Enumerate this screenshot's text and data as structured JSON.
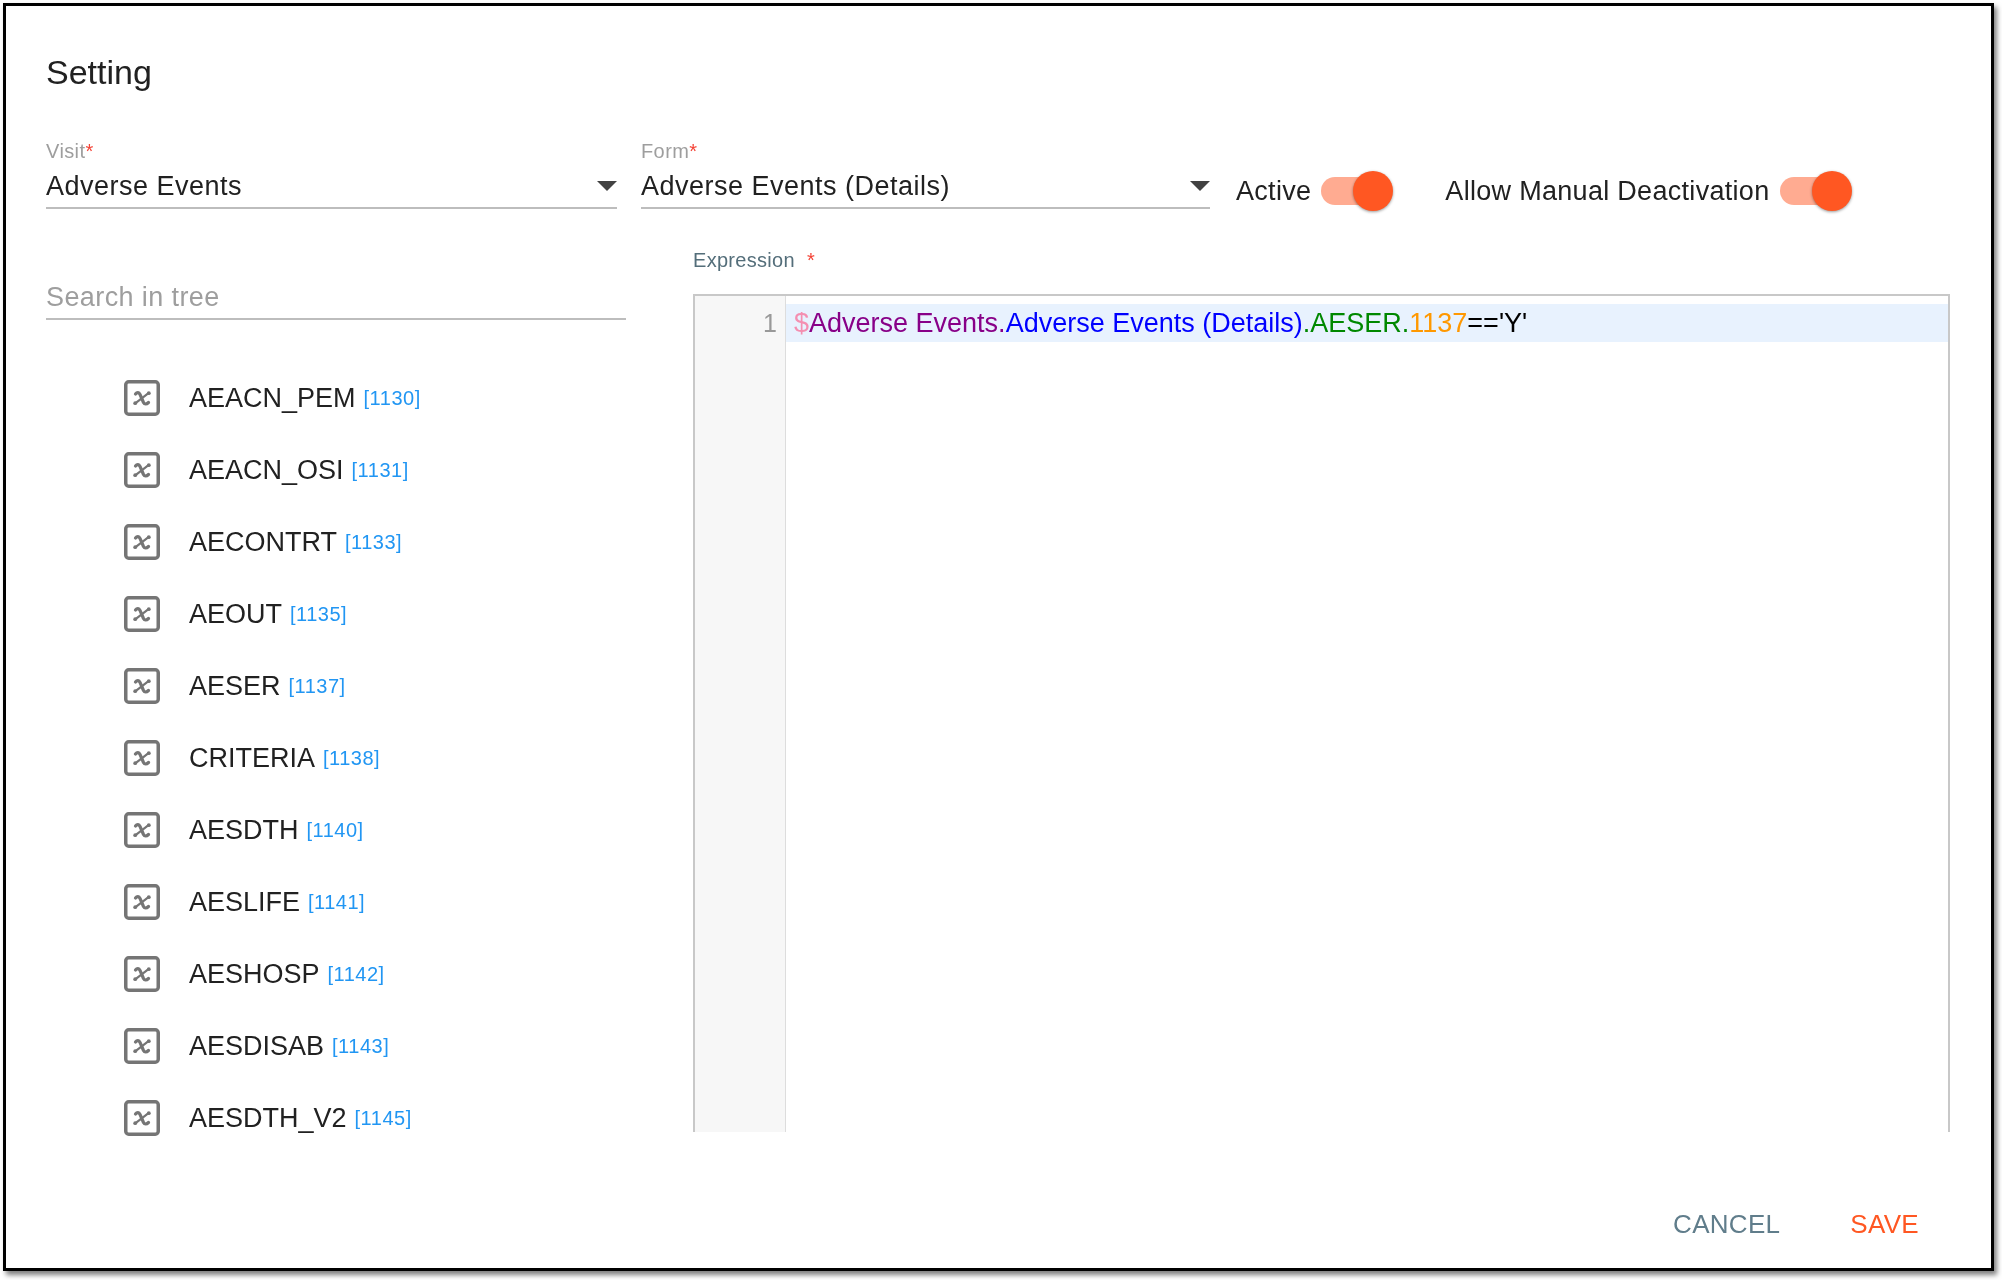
{
  "dialog": {
    "title": "Setting"
  },
  "fields": [
    {
      "label": "Visit",
      "required_mark": "*",
      "value": "Adverse Events"
    },
    {
      "label": "Form",
      "required_mark": "*",
      "value": "Adverse Events (Details)"
    }
  ],
  "toggles": [
    {
      "label": "Active",
      "on": true
    },
    {
      "label": "Allow Manual Deactivation",
      "on": true
    }
  ],
  "tree": {
    "search": {
      "placeholder": "Search in tree"
    },
    "items": [
      {
        "name": "AEACN_PEM",
        "id": "[1130]"
      },
      {
        "name": "AEACN_OSI",
        "id": "[1131]"
      },
      {
        "name": "AECONTRT",
        "id": "[1133]"
      },
      {
        "name": "AEOUT",
        "id": "[1135]"
      },
      {
        "name": "AESER",
        "id": "[1137]"
      },
      {
        "name": "CRITERIA",
        "id": "[1138]"
      },
      {
        "name": "AESDTH",
        "id": "[1140]"
      },
      {
        "name": "AESLIFE",
        "id": "[1141]"
      },
      {
        "name": "AESHOSP",
        "id": "[1142]"
      },
      {
        "name": "AESDISAB",
        "id": "[1143]"
      },
      {
        "name": "AESDTH_V2",
        "id": "[1145]"
      }
    ]
  },
  "expression": {
    "label": "Expression",
    "required_mark": "*",
    "lines": [
      {
        "number": "1",
        "active": true,
        "tokens": [
          {
            "text": "$",
            "color": "#f48fb1"
          },
          {
            "text": "Adverse Events.",
            "color": "#880088"
          },
          {
            "text": "Adverse Events (Details)",
            "color": "#0000ff"
          },
          {
            "text": ".AESER.",
            "color": "#008800"
          },
          {
            "text": "1137",
            "color": "#ff9800"
          },
          {
            "text": "=='Y'",
            "color": "#000000"
          }
        ]
      }
    ]
  },
  "buttons": [
    {
      "label": "CANCEL",
      "kind": "secondary"
    },
    {
      "label": "SAVE",
      "kind": "primary"
    }
  ]
}
